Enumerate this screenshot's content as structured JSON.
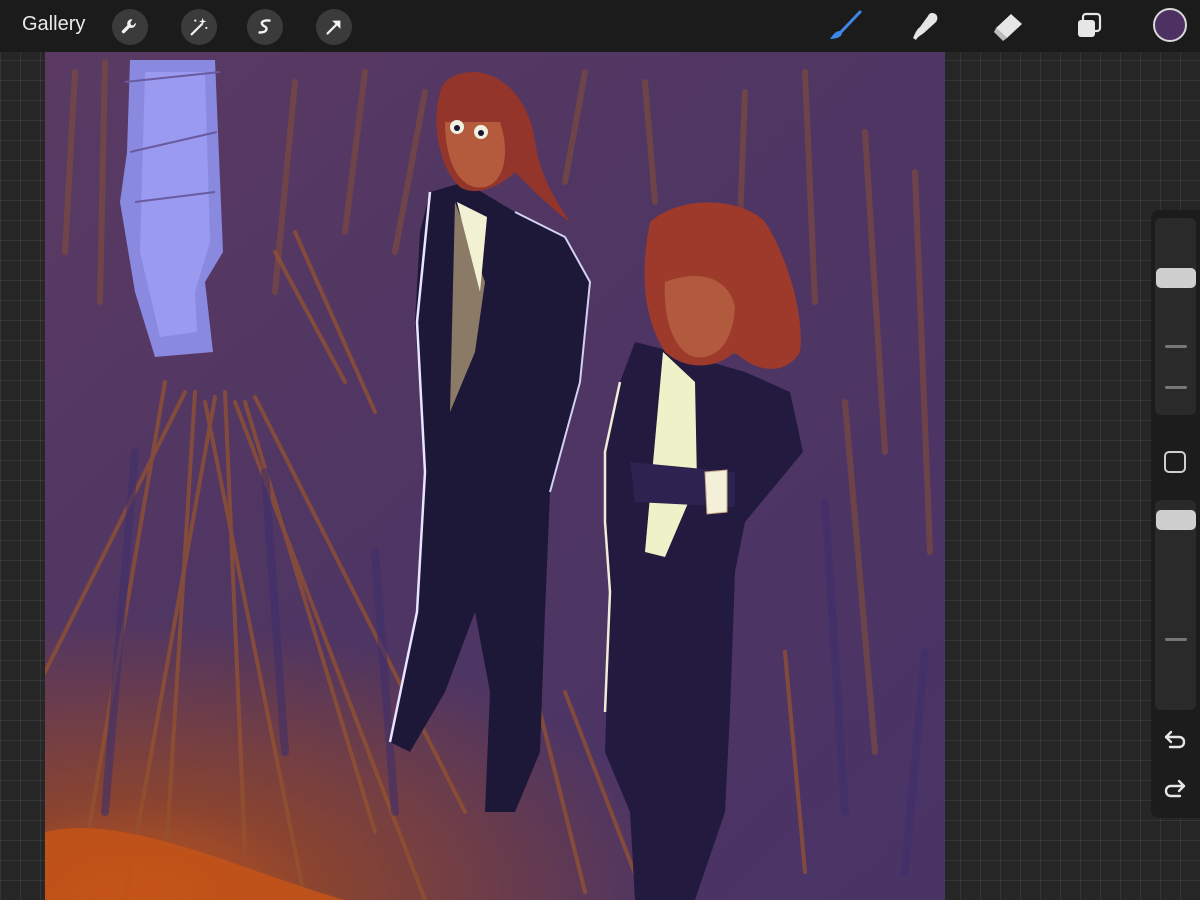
{
  "toolbar": {
    "gallery_label": "Gallery",
    "left_tools": [
      "wrench-icon",
      "magic-wand-icon",
      "selection-icon",
      "transform-arrow-icon"
    ],
    "right_tools": [
      "brush-icon",
      "smudge-icon",
      "eraser-icon",
      "layers-icon"
    ],
    "active_tool": "brush",
    "accent_color": "#3f86e8",
    "current_color": "#4c3162"
  },
  "sidebar": {
    "brush_size_level": 0.72,
    "opacity_level": 0.95,
    "buttons": [
      "modify-square-icon",
      "undo-icon",
      "redo-icon"
    ]
  }
}
